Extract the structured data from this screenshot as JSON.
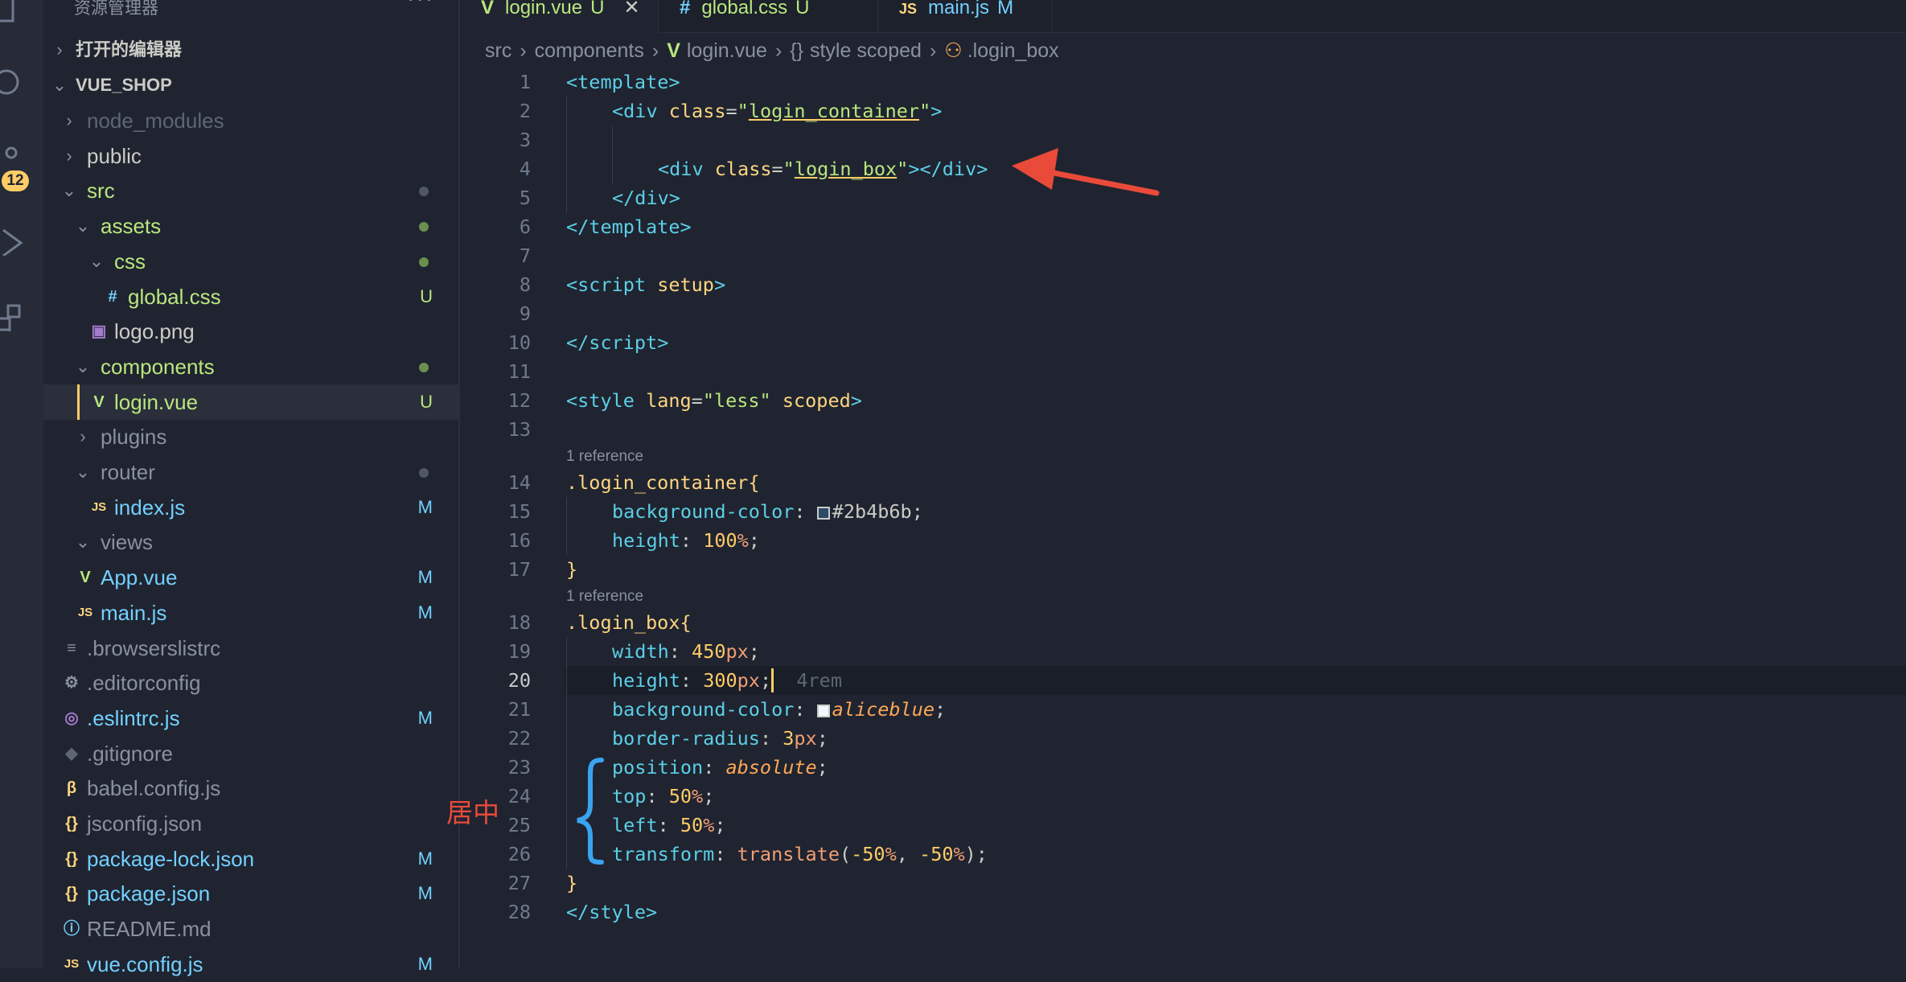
{
  "explorer": {
    "title": "资源管理器",
    "more": "···",
    "open_editors": "打开的编辑器",
    "project": "VUE_SHOP",
    "scm_badge": "12",
    "items": [
      {
        "label": "node_modules",
        "depth": 1,
        "kind": "folder-closed",
        "color": "#5c6773",
        "icon": "",
        "status": ""
      },
      {
        "label": "public",
        "depth": 1,
        "kind": "folder-closed",
        "color": "#cbccc6",
        "icon": "",
        "status": ""
      },
      {
        "label": "src",
        "depth": 1,
        "kind": "folder-open",
        "color": "#bae67e",
        "icon": "",
        "status": "dot-gray"
      },
      {
        "label": "assets",
        "depth": 2,
        "kind": "folder-open",
        "color": "#bae67e",
        "icon": "",
        "status": "dot-green"
      },
      {
        "label": "css",
        "depth": 3,
        "kind": "folder-open",
        "color": "#bae67e",
        "icon": "",
        "status": "dot-green"
      },
      {
        "label": "global.css",
        "depth": 4,
        "kind": "file",
        "color": "#bae67e",
        "icon": "#",
        "status": "U"
      },
      {
        "label": "logo.png",
        "depth": 3,
        "kind": "file",
        "color": "#cbccc6",
        "icon": "img",
        "status": ""
      },
      {
        "label": "components",
        "depth": 2,
        "kind": "folder-open",
        "color": "#bae67e",
        "icon": "",
        "status": "dot-green"
      },
      {
        "label": "login.vue",
        "depth": 3,
        "kind": "file",
        "color": "#bae67e",
        "icon": "V",
        "status": "U",
        "selected": true
      },
      {
        "label": "plugins",
        "depth": 2,
        "kind": "folder-closed",
        "color": "#8a919e",
        "icon": "",
        "status": ""
      },
      {
        "label": "router",
        "depth": 2,
        "kind": "folder-open",
        "color": "#8a919e",
        "icon": "",
        "status": "dot-gray"
      },
      {
        "label": "index.js",
        "depth": 3,
        "kind": "file",
        "color": "#73d0ff",
        "icon": "JS",
        "status": "M"
      },
      {
        "label": "views",
        "depth": 2,
        "kind": "folder-open",
        "color": "#8a919e",
        "icon": "",
        "status": ""
      },
      {
        "label": "App.vue",
        "depth": 2,
        "kind": "file",
        "color": "#73d0ff",
        "icon": "V",
        "status": "M"
      },
      {
        "label": "main.js",
        "depth": 2,
        "kind": "file",
        "color": "#73d0ff",
        "icon": "JS",
        "status": "M"
      },
      {
        "label": ".browserslistrc",
        "depth": 1,
        "kind": "file",
        "color": "#8a919e",
        "icon": "≡",
        "status": ""
      },
      {
        "label": ".editorconfig",
        "depth": 1,
        "kind": "file",
        "color": "#8a919e",
        "icon": "⚙",
        "status": ""
      },
      {
        "label": ".eslintrc.js",
        "depth": 1,
        "kind": "file",
        "color": "#73d0ff",
        "icon": "◎",
        "status": "M"
      },
      {
        "label": ".gitignore",
        "depth": 1,
        "kind": "file",
        "color": "#8a919e",
        "icon": "◆",
        "status": ""
      },
      {
        "label": "babel.config.js",
        "depth": 1,
        "kind": "file",
        "color": "#8a919e",
        "icon": "β",
        "status": ""
      },
      {
        "label": "jsconfig.json",
        "depth": 1,
        "kind": "file",
        "color": "#8a919e",
        "icon": "{}",
        "status": ""
      },
      {
        "label": "package-lock.json",
        "depth": 1,
        "kind": "file",
        "color": "#73d0ff",
        "icon": "{}",
        "status": "M"
      },
      {
        "label": "package.json",
        "depth": 1,
        "kind": "file",
        "color": "#73d0ff",
        "icon": "{}",
        "status": "M"
      },
      {
        "label": "README.md",
        "depth": 1,
        "kind": "file",
        "color": "#8a919e",
        "icon": "ⓘ",
        "status": ""
      },
      {
        "label": "vue.config.js",
        "depth": 1,
        "kind": "file",
        "color": "#73d0ff",
        "icon": "JS",
        "status": "M"
      }
    ]
  },
  "tabs": [
    {
      "icon": "V",
      "name": "login.vue",
      "badge": "U",
      "active": true,
      "close": "✕"
    },
    {
      "icon": "#",
      "name": "global.css",
      "badge": "U",
      "active": false
    },
    {
      "icon": "JS",
      "name": "main.js",
      "badge": "M",
      "active": false
    }
  ],
  "breadcrumb": [
    {
      "icon": "",
      "text": "src"
    },
    {
      "icon": "",
      "text": "components"
    },
    {
      "icon": "V",
      "text": "login.vue"
    },
    {
      "icon": "{}",
      "text": "style scoped"
    },
    {
      "icon": "⚇",
      "text": ".login_box"
    }
  ],
  "code": {
    "current_line": 20,
    "reference_label": "1 reference",
    "lines": [
      {
        "n": 1,
        "indent": 0,
        "tokens": [
          [
            "t-punct",
            "<"
          ],
          [
            "t-tag",
            "template"
          ],
          [
            "t-punct",
            ">"
          ]
        ]
      },
      {
        "n": 2,
        "indent": 1,
        "tokens": [
          [
            "t-punct",
            "<"
          ],
          [
            "t-tag",
            "div"
          ],
          [
            "t-plain",
            " "
          ],
          [
            "t-attr",
            "class"
          ],
          [
            "t-plain",
            "="
          ],
          [
            "t-str",
            "\""
          ],
          [
            "t-str ul",
            "login_container"
          ],
          [
            "t-str",
            "\""
          ],
          [
            "t-punct",
            ">"
          ]
        ]
      },
      {
        "n": 3,
        "indent": 0,
        "tokens": []
      },
      {
        "n": 4,
        "indent": 2,
        "tokens": [
          [
            "t-punct",
            "<"
          ],
          [
            "t-tag",
            "div"
          ],
          [
            "t-plain",
            " "
          ],
          [
            "t-attr",
            "class"
          ],
          [
            "t-plain",
            "="
          ],
          [
            "t-str",
            "\""
          ],
          [
            "t-str ul",
            "login_box"
          ],
          [
            "t-str",
            "\""
          ],
          [
            "t-punct",
            "></"
          ],
          [
            "t-tag",
            "div"
          ],
          [
            "t-punct",
            ">"
          ]
        ]
      },
      {
        "n": 5,
        "indent": 1,
        "tokens": [
          [
            "t-punct",
            "</"
          ],
          [
            "t-tag",
            "div"
          ],
          [
            "t-punct",
            ">"
          ]
        ]
      },
      {
        "n": 6,
        "indent": 0,
        "tokens": [
          [
            "t-punct",
            "</"
          ],
          [
            "t-tag",
            "template"
          ],
          [
            "t-punct",
            ">"
          ]
        ]
      },
      {
        "n": 7,
        "indent": 0,
        "tokens": []
      },
      {
        "n": 8,
        "indent": 0,
        "tokens": [
          [
            "t-punct",
            "<"
          ],
          [
            "t-tag",
            "script"
          ],
          [
            "t-plain",
            " "
          ],
          [
            "t-attr",
            "setup"
          ],
          [
            "t-punct",
            ">"
          ]
        ]
      },
      {
        "n": 9,
        "indent": 0,
        "tokens": []
      },
      {
        "n": 10,
        "indent": 0,
        "tokens": [
          [
            "t-punct",
            "</"
          ],
          [
            "t-tag",
            "script"
          ],
          [
            "t-punct",
            ">"
          ]
        ]
      },
      {
        "n": 11,
        "indent": 0,
        "tokens": []
      },
      {
        "n": 12,
        "indent": 0,
        "tokens": [
          [
            "t-punct",
            "<"
          ],
          [
            "t-tag",
            "style"
          ],
          [
            "t-plain",
            " "
          ],
          [
            "t-attr",
            "lang"
          ],
          [
            "t-plain",
            "="
          ],
          [
            "t-str",
            "\"less\""
          ],
          [
            "t-plain",
            " "
          ],
          [
            "t-attr",
            "scoped"
          ],
          [
            "t-punct",
            ">"
          ]
        ]
      },
      {
        "n": 13,
        "indent": 0,
        "tokens": []
      },
      {
        "n": 14,
        "indent": 0,
        "ref": true,
        "tokens": [
          [
            "t-sel",
            ".login_container"
          ],
          [
            "t-attr",
            "{"
          ]
        ]
      },
      {
        "n": 15,
        "indent": 1,
        "tokens": [
          [
            "t-prop",
            "background-color"
          ],
          [
            "t-plain",
            ": "
          ],
          [
            "swatch",
            "#2b4b6b"
          ],
          [
            "t-plain",
            "#2b4b6b;"
          ]
        ]
      },
      {
        "n": 16,
        "indent": 1,
        "tokens": [
          [
            "t-prop",
            "height"
          ],
          [
            "t-plain",
            ": "
          ],
          [
            "t-num",
            "100"
          ],
          [
            "t-unit",
            "%"
          ],
          [
            "t-plain",
            ";"
          ]
        ]
      },
      {
        "n": 17,
        "indent": 0,
        "tokens": [
          [
            "t-attr",
            "}"
          ]
        ]
      },
      {
        "n": 18,
        "indent": 0,
        "ref": true,
        "tokens": [
          [
            "t-sel",
            ".login_box"
          ],
          [
            "t-attr",
            "{"
          ]
        ]
      },
      {
        "n": 19,
        "indent": 1,
        "tokens": [
          [
            "t-prop",
            "width"
          ],
          [
            "t-plain",
            ": "
          ],
          [
            "t-num",
            "450"
          ],
          [
            "t-unit",
            "px"
          ],
          [
            "t-plain",
            ";"
          ]
        ]
      },
      {
        "n": 20,
        "indent": 1,
        "tokens": [
          [
            "t-prop",
            "height"
          ],
          [
            "t-plain",
            ": "
          ],
          [
            "t-num",
            "300"
          ],
          [
            "t-unit",
            "px"
          ],
          [
            "t-plain",
            ";"
          ],
          [
            "caret",
            ""
          ],
          [
            "t-ghost",
            "  4rem"
          ]
        ]
      },
      {
        "n": 21,
        "indent": 1,
        "tokens": [
          [
            "t-prop",
            "background-color"
          ],
          [
            "t-plain",
            ": "
          ],
          [
            "swatch",
            "#f0f8ff"
          ],
          [
            "t-kw",
            "aliceblue"
          ],
          [
            "t-plain",
            ";"
          ]
        ]
      },
      {
        "n": 22,
        "indent": 1,
        "tokens": [
          [
            "t-prop",
            "border-radius"
          ],
          [
            "t-plain",
            ": "
          ],
          [
            "t-num",
            "3"
          ],
          [
            "t-unit",
            "px"
          ],
          [
            "t-plain",
            ";"
          ]
        ]
      },
      {
        "n": 23,
        "indent": 1,
        "tokens": [
          [
            "t-prop",
            "position"
          ],
          [
            "t-plain",
            ": "
          ],
          [
            "t-kw",
            "absolute"
          ],
          [
            "t-plain",
            ";"
          ]
        ]
      },
      {
        "n": 24,
        "indent": 1,
        "tokens": [
          [
            "t-prop",
            "top"
          ],
          [
            "t-plain",
            ": "
          ],
          [
            "t-num",
            "50"
          ],
          [
            "t-unit",
            "%"
          ],
          [
            "t-plain",
            ";"
          ]
        ]
      },
      {
        "n": 25,
        "indent": 1,
        "tokens": [
          [
            "t-prop",
            "left"
          ],
          [
            "t-plain",
            ": "
          ],
          [
            "t-num",
            "50"
          ],
          [
            "t-unit",
            "%"
          ],
          [
            "t-plain",
            ";"
          ]
        ]
      },
      {
        "n": 26,
        "indent": 1,
        "tokens": [
          [
            "t-prop",
            "transform"
          ],
          [
            "t-plain",
            ": "
          ],
          [
            "t-fn",
            "translate"
          ],
          [
            "t-plain",
            "("
          ],
          [
            "t-num",
            "-50"
          ],
          [
            "t-unit",
            "%"
          ],
          [
            "t-plain",
            ", "
          ],
          [
            "t-num",
            "-50"
          ],
          [
            "t-unit",
            "%"
          ],
          [
            "t-plain",
            ");"
          ]
        ]
      },
      {
        "n": 27,
        "indent": 0,
        "tokens": [
          [
            "t-attr",
            "}"
          ]
        ]
      },
      {
        "n": 28,
        "indent": 0,
        "tokens": [
          [
            "t-punct",
            "</"
          ],
          [
            "t-tag",
            "style"
          ],
          [
            "t-punct",
            ">"
          ]
        ]
      }
    ]
  },
  "annotation": {
    "text": "居中",
    "color": "#e94a3a",
    "brace_color": "#3aa3f0"
  }
}
